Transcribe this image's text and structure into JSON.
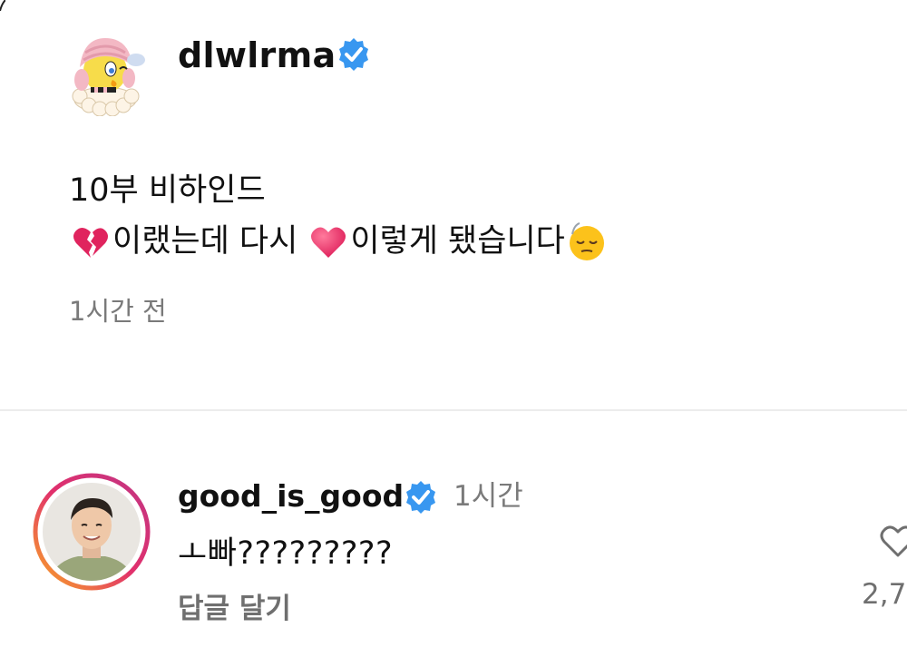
{
  "post": {
    "username": "dlwlrma",
    "verified": true,
    "caption_line1": "10부 비하인드",
    "caption_line2_parts": [
      "이랬는데 다시",
      "이렇게 됐습니다"
    ],
    "caption_emojis": [
      "broken-heart-emoji",
      "red-heart-emoji",
      "relieved-face-emoji"
    ],
    "time_ago": "1시간 전"
  },
  "comment": {
    "username": "good_is_good",
    "verified": true,
    "time": "1시간",
    "text": "ㅗ빠?????????",
    "reply_label": "답글 달기",
    "like_count": "2,7"
  },
  "colors": {
    "verified_blue": "#3897f0",
    "story_ring_start": "#f9a825",
    "story_ring_end": "#c13584",
    "secondary_text": "#7a7a7a"
  }
}
